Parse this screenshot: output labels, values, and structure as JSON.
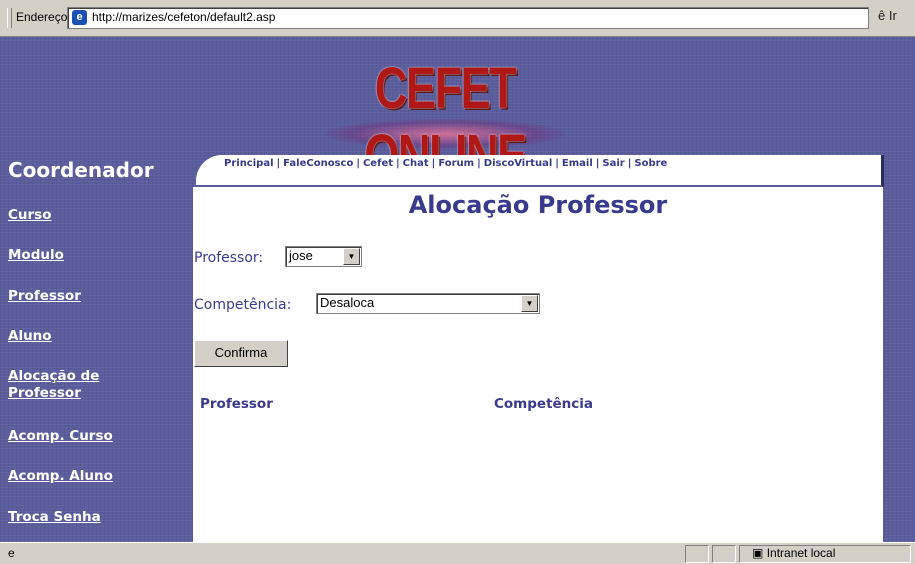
{
  "browser": {
    "address_label": "Endereço",
    "url": "http://marizes/cefeton/default2.asp",
    "go_glyph": "ê Ir"
  },
  "header": {
    "logo_text": "CEFET ONLINE",
    "role": "Coordenador"
  },
  "menu": {
    "items": [
      "Principal",
      "FaleConosco",
      "Cefet",
      "Chat",
      "Forum",
      "DiscoVirtual",
      "Email",
      "Sair",
      "Sobre"
    ]
  },
  "sidebar": {
    "items": [
      {
        "label": "Curso"
      },
      {
        "label": "Modulo"
      },
      {
        "label": "Professor"
      },
      {
        "label": "Aluno"
      },
      {
        "label": "Alocação de"
      },
      {
        "label": "Professor"
      },
      {
        "label": "Acomp. Curso"
      },
      {
        "label": "Acomp. Aluno"
      },
      {
        "label": "Troca Senha"
      }
    ]
  },
  "main": {
    "title": "Alocação Professor",
    "professor_label": "Professor:",
    "professor_value": "jose",
    "competencia_label": "Competência:",
    "competencia_value": "Desaloca",
    "confirm_label": "Confirma",
    "table_headers": [
      "Professor",
      "Competência"
    ]
  },
  "status": {
    "zone": "Intranet local"
  }
}
